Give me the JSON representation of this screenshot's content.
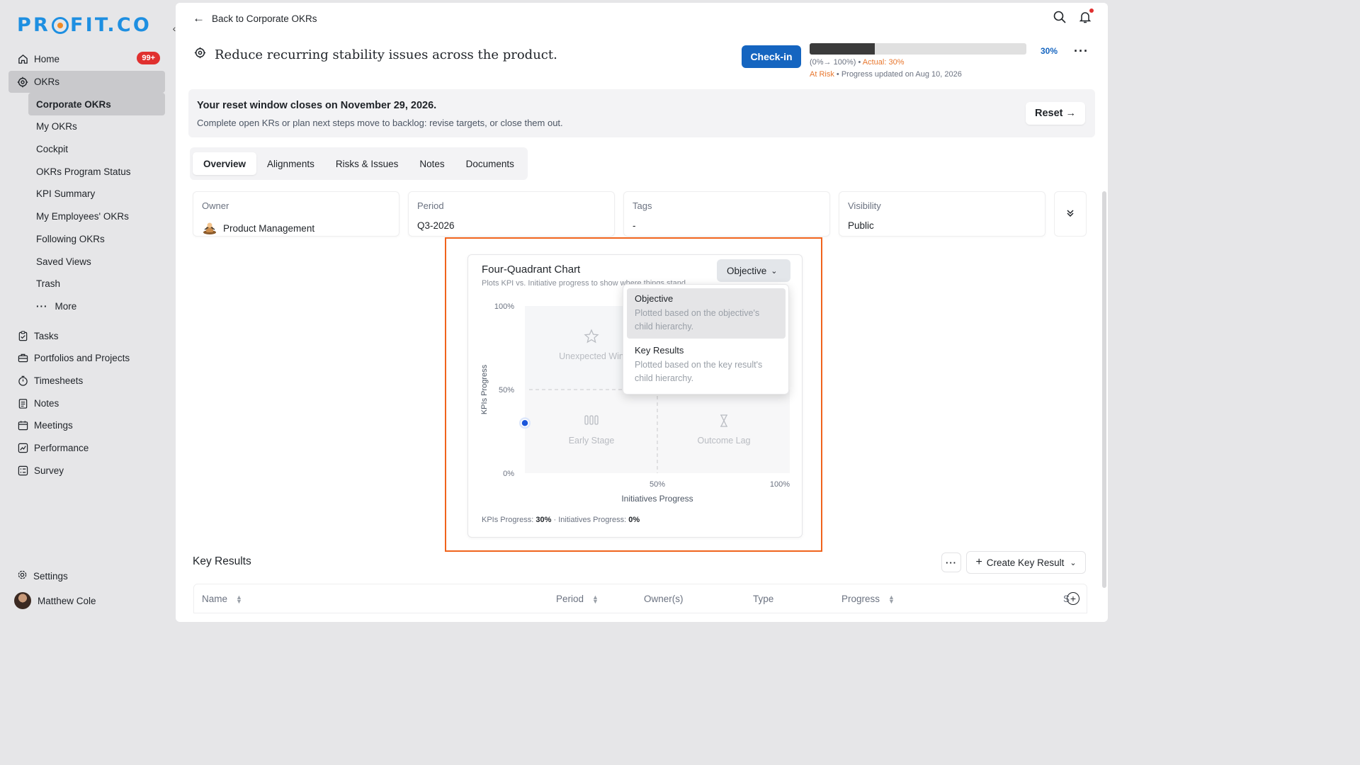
{
  "brand": {
    "logo_text_start": "PR",
    "logo_text_end": "FIT.CO"
  },
  "sidebar": {
    "items": [
      {
        "label": "Home",
        "badge": "99+"
      },
      {
        "label": "OKRs"
      }
    ],
    "okr_sub": [
      {
        "label": "Corporate OKRs"
      },
      {
        "label": "My OKRs"
      },
      {
        "label": "Cockpit"
      },
      {
        "label": "OKRs Program Status"
      },
      {
        "label": "KPI Summary"
      },
      {
        "label": "My Employees' OKRs"
      },
      {
        "label": "Following OKRs"
      },
      {
        "label": "Saved Views"
      },
      {
        "label": "Trash"
      },
      {
        "label": "More"
      }
    ],
    "items2": [
      {
        "label": "Tasks"
      },
      {
        "label": "Portfolios and Projects"
      },
      {
        "label": "Timesheets"
      },
      {
        "label": "Notes"
      },
      {
        "label": "Meetings"
      },
      {
        "label": "Performance"
      },
      {
        "label": "Survey"
      }
    ],
    "settings": "Settings",
    "user": "Matthew Cole"
  },
  "header": {
    "back_label": "Back to Corporate OKRs",
    "objective_title": "Reduce recurring stability issues across the product.",
    "checkin_label": "Check-in",
    "progress_percent": "30%",
    "progress_fraction": 0.3,
    "progress_range": "(0%→ 100%) •",
    "actual_label": "Actual: 30%",
    "status": "At Risk",
    "updated": "• Progress updated on Aug 10, 2026"
  },
  "reset": {
    "title": "Your reset window closes on November 29, 2026.",
    "subtitle": "Complete open KRs or plan next steps move to backlog: revise targets, or close them out.",
    "button": "Reset →"
  },
  "tabs": [
    "Overview",
    "Alignments",
    "Risks & Issues",
    "Notes",
    "Documents"
  ],
  "info": {
    "owner_label": "Owner",
    "owner_value": "Product Management",
    "period_label": "Period",
    "period_value": "Q3-2026",
    "tags_label": "Tags",
    "tags_value": "-",
    "visibility_label": "Visibility",
    "visibility_value": "Public"
  },
  "chart": {
    "title": "Four-Quadrant Chart",
    "subtitle": "Plots KPI vs. Initiative progress to show where things stand.",
    "dropdown_value": "Objective",
    "options": [
      {
        "name": "Objective",
        "desc": "Plotted based on the objective's child hierarchy."
      },
      {
        "name": "Key Results",
        "desc": "Plotted based on the key result's child hierarchy."
      }
    ],
    "footer_kpi_label": "KPIs Progress:",
    "footer_kpi_value": "30%",
    "footer_init_label": "· Initiatives Progress:",
    "footer_init_value": "0%"
  },
  "chart_data": {
    "type": "scatter",
    "title": "Four-Quadrant Chart",
    "xlabel": "Initiatives Progress",
    "ylabel": "KPIs Progress",
    "x_ticks": [
      "50%",
      "100%"
    ],
    "y_ticks": [
      "100%",
      "50%",
      "0%"
    ],
    "xlim": [
      0,
      100
    ],
    "ylim": [
      0,
      100
    ],
    "quadrants": [
      "Unexpected Win",
      "Early Stage",
      "Outcome Lag"
    ],
    "points": [
      {
        "x": 0,
        "y": 30
      }
    ],
    "point_color": "#1a56db"
  },
  "key_results": {
    "title": "Key Results",
    "create_label": "Create Key Result",
    "columns": [
      "Name",
      "Period",
      "Owner(s)",
      "Type",
      "Progress",
      "S"
    ]
  },
  "colors": {
    "accent": "#1565c0",
    "highlight": "#f0631c",
    "warning": "#e8772e",
    "badge": "#e0302f"
  }
}
